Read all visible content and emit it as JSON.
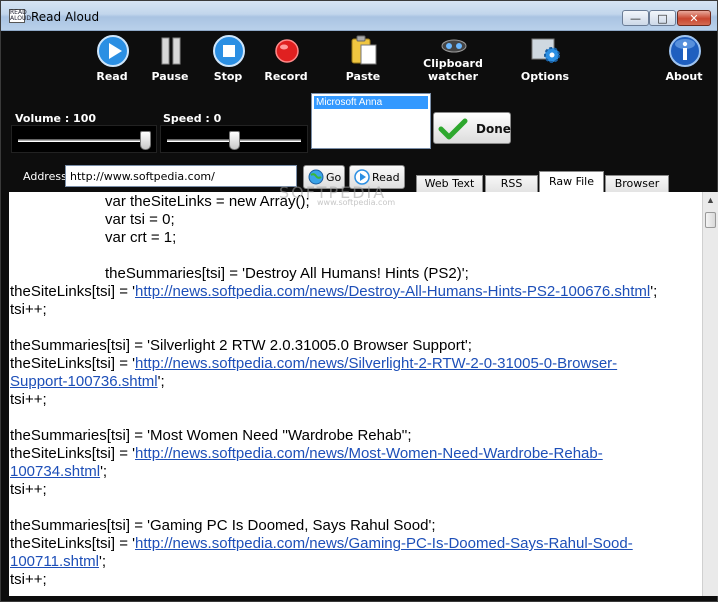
{
  "window": {
    "title": "Read Aloud",
    "app_icon_text": "READ ALOUD",
    "controls": {
      "minimize": "—",
      "maximize": "□",
      "close": "✕"
    }
  },
  "toolbar": {
    "play": {
      "label": "Read",
      "icon": "play-icon",
      "color": "#2b8fe3"
    },
    "pause": {
      "label": "Pause",
      "icon": "pause-icon"
    },
    "stop": {
      "label": "Stop",
      "icon": "stop-icon",
      "color": "#2b8fe3"
    },
    "record": {
      "label": "Record",
      "icon": "record-icon",
      "color": "#e02020"
    },
    "paste": {
      "label": "Paste",
      "icon": "paste-icon"
    },
    "clipboard": {
      "label_line1": "Clipboard",
      "label_line2": "watcher",
      "icon": "clipboard-watcher-icon"
    },
    "options": {
      "label": "Options",
      "icon": "gear-icon"
    },
    "about": {
      "label": "About",
      "icon": "info-icon"
    }
  },
  "controls": {
    "volume": {
      "label": "Volume : 100",
      "value": 100
    },
    "speed": {
      "label": "Speed : 0",
      "value": 0
    },
    "voices": [
      "Microsoft Anna"
    ],
    "selected_voice": "Microsoft Anna",
    "done_label": "Done"
  },
  "address": {
    "label": "Address",
    "value": "http://www.softpedia.com/",
    "go_label": "Go",
    "read_label": "Read"
  },
  "tabs": [
    "Web Text",
    "RSS",
    "Raw File",
    "Browser"
  ],
  "active_tab": "Raw File",
  "watermark": {
    "main": "SOFTPEDIA",
    "sub": "www.softpedia.com"
  },
  "content": {
    "lines": [
      {
        "text": "var theSiteLinks = new Array();"
      },
      {
        "text": "var tsi = 0;"
      },
      {
        "text": "var crt = 1;"
      },
      {
        "text": "theSummaries[tsi] = 'Destroy All Humans! Hints (PS2)';"
      },
      {
        "pre": "theSiteLinks[tsi] = '",
        "link": "http://news.softpedia.com/news/Destroy-All-Humans-Hints-PS2-100676.shtml",
        "post": "';"
      },
      {
        "text": "tsi++;"
      },
      {
        "text": "theSummaries[tsi] = 'Silverlight 2 RTW 2.0.31005.0 Browser Support';"
      },
      {
        "pre": "theSiteLinks[tsi] = '",
        "link": "http://news.softpedia.com/news/Silverlight-2-RTW-2-0-31005-0-Browser-",
        "post": ""
      },
      {
        "pre": "",
        "link": "Support-100736.shtml",
        "post": "';"
      },
      {
        "text": "tsi++;"
      },
      {
        "text": "theSummaries[tsi] = 'Most Women Need ''Wardrobe Rehab'';"
      },
      {
        "pre": "theSiteLinks[tsi] = '",
        "link": "http://news.softpedia.com/news/Most-Women-Need-Wardrobe-Rehab-",
        "post": ""
      },
      {
        "pre": "",
        "link": "100734.shtml",
        "post": "';"
      },
      {
        "text": "tsi++;"
      },
      {
        "text": "theSummaries[tsi] = 'Gaming PC Is Doomed, Says Rahul Sood';"
      },
      {
        "pre": "theSiteLinks[tsi] = '",
        "link": "http://news.softpedia.com/news/Gaming-PC-Is-Doomed-Says-Rahul-Sood-",
        "post": ""
      },
      {
        "pre": "",
        "link": "100711.shtml",
        "post": "';"
      },
      {
        "text": "tsi++;"
      }
    ]
  }
}
